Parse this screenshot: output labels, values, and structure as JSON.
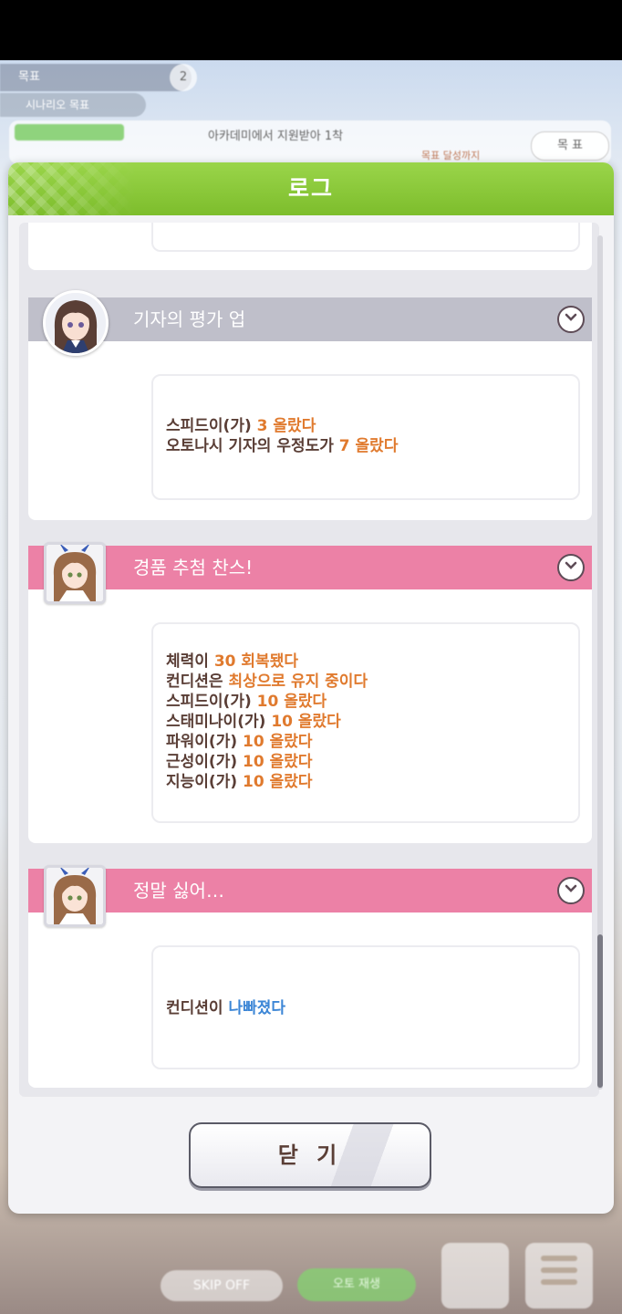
{
  "background": {
    "chip1": "목표",
    "chip1_badge": "2",
    "chip2": "시나리오 목표",
    "card_text": "아카데미에서 지원받아 1착",
    "card_subtext": "목표 달성까지",
    "card_button": "목 표",
    "bottom_skip": "SKIP OFF",
    "bottom_auto": "오토 재생"
  },
  "dialog": {
    "title": "로그",
    "close_label": "닫 기"
  },
  "entries": [
    {
      "title": "기자의 평가 업",
      "lines": [
        {
          "prefix": "스피드이(가) ",
          "value": "3 올랐다"
        },
        {
          "prefix": "오토나시 기자의 우정도가 ",
          "value": "7 올랐다"
        }
      ]
    },
    {
      "title": "경품 추첨 찬스!",
      "lines": [
        {
          "prefix": "체력이 ",
          "value": "30 회복됐다"
        },
        {
          "prefix": "컨디션은 ",
          "value": "최상으로 유지 중이다"
        },
        {
          "prefix": "스피드이(가) ",
          "value": "10 올랐다"
        },
        {
          "prefix": "스태미나이(가) ",
          "value": "10 올랐다"
        },
        {
          "prefix": "파워이(가) ",
          "value": "10 올랐다"
        },
        {
          "prefix": "근성이(가) ",
          "value": "10 올랐다"
        },
        {
          "prefix": "지능이(가) ",
          "value": "10 올랐다"
        }
      ]
    },
    {
      "title": "정말 싫어…",
      "lines": [
        {
          "prefix": "컨디션이 ",
          "value": "나빠졌다"
        }
      ]
    }
  ],
  "colors": {
    "header_green": "#8bc93c",
    "head_grey": "#bfbfca",
    "head_pink": "#ec81a6",
    "value_orange": "#e07a2e",
    "value_blue": "#3c86d6"
  }
}
